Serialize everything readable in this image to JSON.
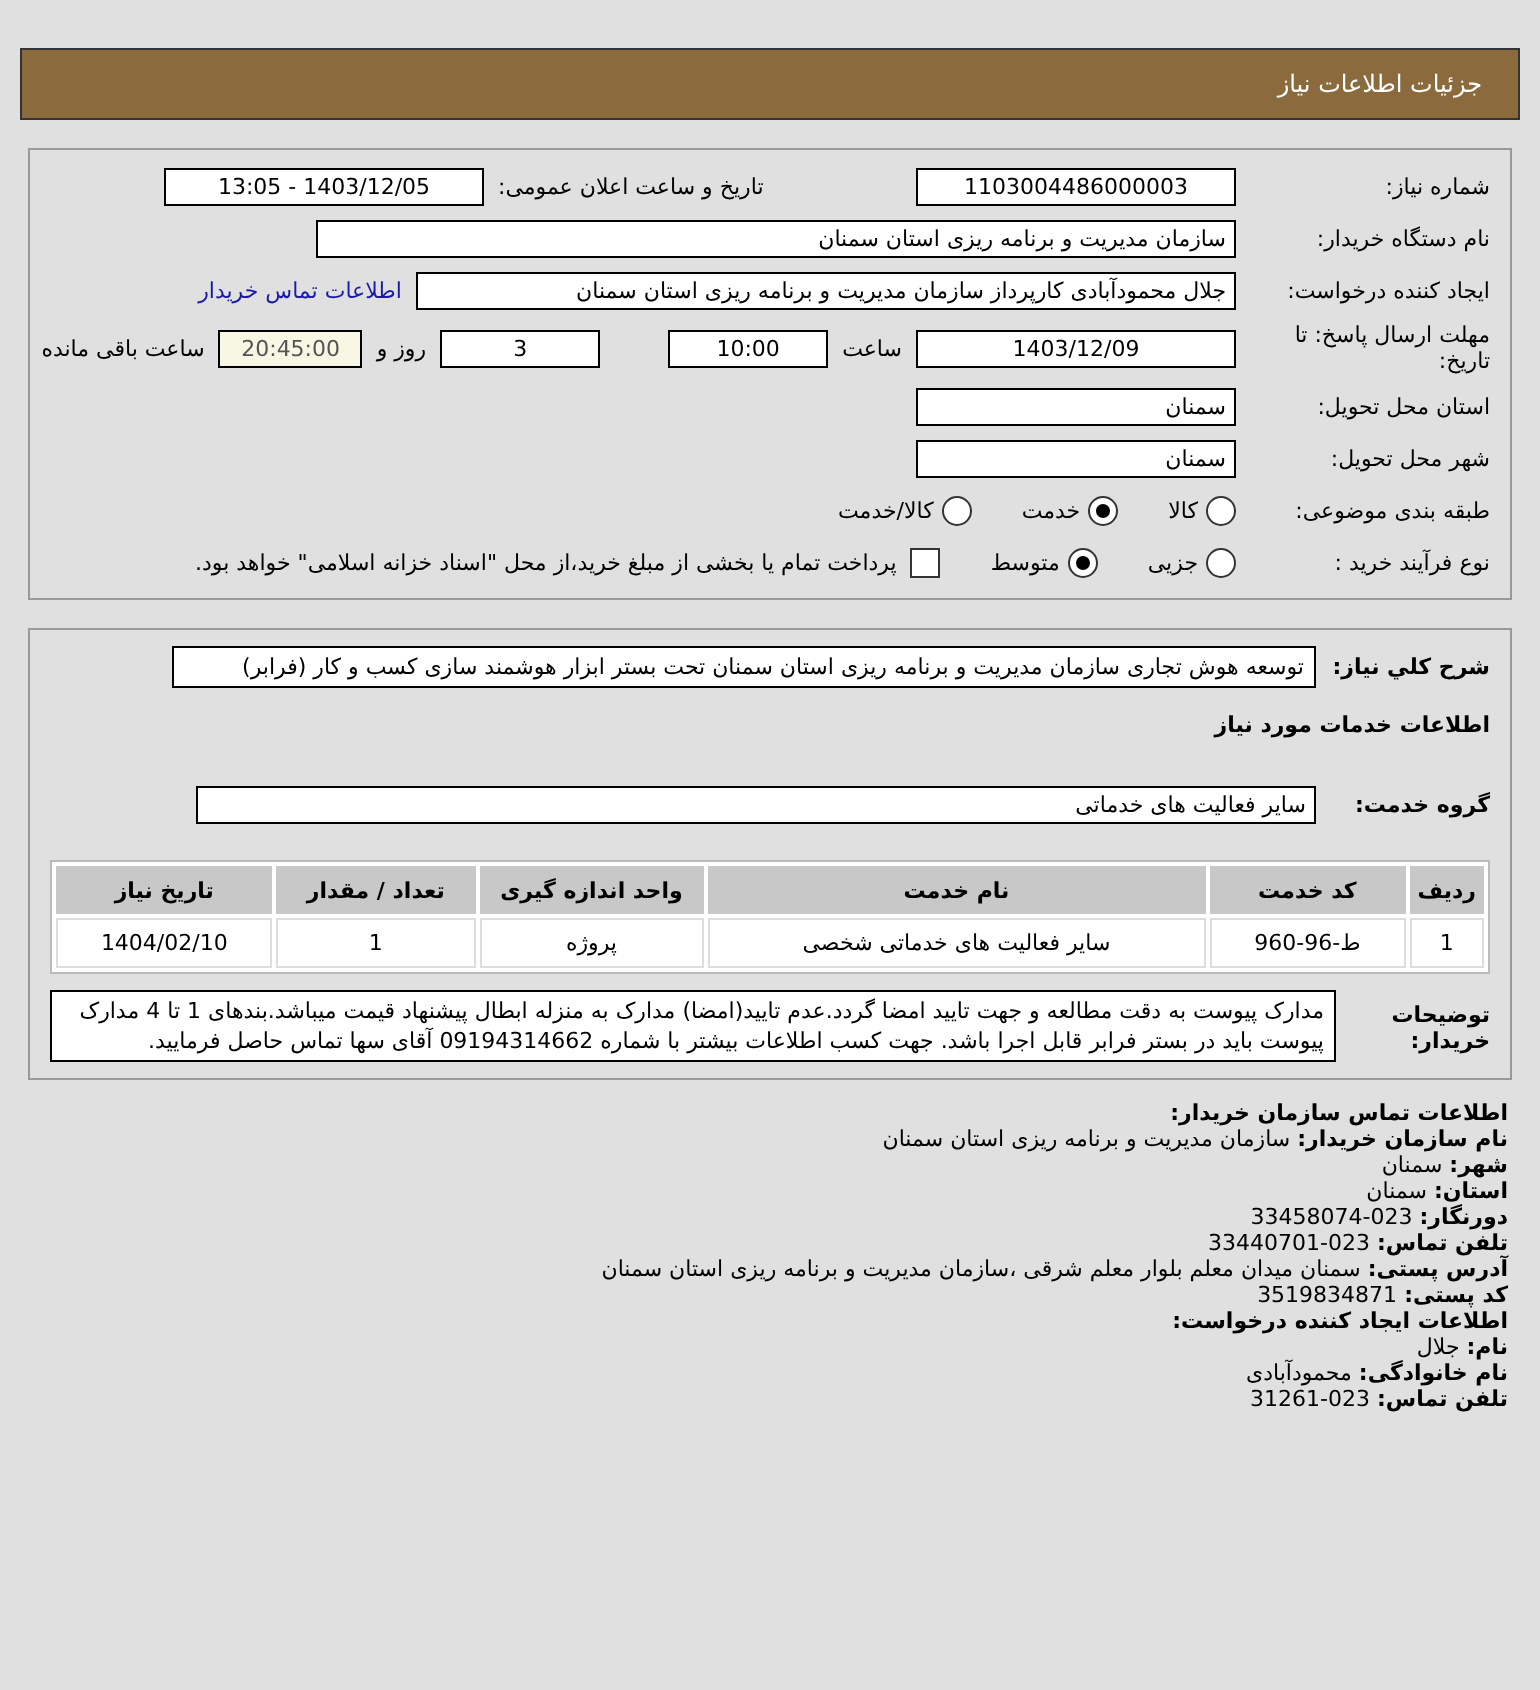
{
  "header": {
    "title": "جزئیات اطلاعات نیاز"
  },
  "need_info": {
    "need_number_label": "شماره نیاز:",
    "need_number": "1103004486000003",
    "announce_label": "تاریخ و ساعت اعلان عمومی:",
    "announce_value": "1403/12/05 - 13:05",
    "buyer_label": "نام دستگاه خریدار:",
    "buyer": "سازمان مدیریت و برنامه ریزی استان سمنان",
    "creator_label": "ایجاد کننده درخواست:",
    "creator": "جلال محمودآبادی کارپرداز سازمان مدیریت و برنامه ریزی استان سمنان",
    "contact_link": "اطلاعات تماس خریدار",
    "deadline_label": "مهلت ارسال پاسخ: تا تاریخ:",
    "deadline_date": "1403/12/09",
    "time_label": "ساعت",
    "deadline_time": "10:00",
    "days": "3",
    "days_label": "روز و",
    "remaining": "20:45:00",
    "remaining_label": "ساعت باقی مانده",
    "province_label": "استان محل تحویل:",
    "province": "سمنان",
    "city_label": "شهر محل تحویل:",
    "city": "سمنان",
    "category_label": "طبقه بندی موضوعی:",
    "category_options": [
      {
        "label": "کالا",
        "selected": false
      },
      {
        "label": "خدمت",
        "selected": true
      },
      {
        "label": "کالا/خدمت",
        "selected": false
      }
    ],
    "process_label": "نوع فرآیند خرید :",
    "process_options": [
      {
        "label": "جزیی",
        "selected": false
      },
      {
        "label": "متوسط",
        "selected": true
      }
    ],
    "treasury": {
      "label": "پرداخت تمام یا بخشی از مبلغ خرید،از محل \"اسناد خزانه اسلامی\" خواهد بود.",
      "checked": false
    }
  },
  "details": {
    "summary_label": "شرح کلي نياز:",
    "summary": "توسعه هوش تجاری سازمان مدیریت و برنامه ریزی استان سمنان تحت بستر ابزار هوشمند سازی کسب و کار (فرابر)",
    "services_title": "اطلاعات خدمات مورد نیاز",
    "group_label": "گروه خدمت:",
    "group": "سایر فعالیت های خدماتی",
    "table": {
      "columns": [
        "ردیف",
        "کد خدمت",
        "نام خدمت",
        "واحد اندازه گیری",
        "تعداد / مقدار",
        "تاریخ نیاز"
      ],
      "rows": [
        [
          "1",
          "ط-96-960",
          "سایر فعالیت های خدماتی شخصی",
          "پروژه",
          "1",
          "1404/02/10"
        ]
      ]
    },
    "notes_label": "توضیحات خریدار:",
    "notes": "مدارک پیوست به دقت مطالعه و جهت تایید امضا گردد.عدم تایید(امضا) مدارک به منزله ابطال پیشنهاد قیمت میباشد.بندهای 1 تا 4 مدارک پیوست باید در بستر فرابر قابل اجرا باشد. جهت کسب اطلاعات بیشتر با شماره 09194314662 آقای سها تماس حاصل فرمایید."
  },
  "contact": [
    {
      "kind": "heading",
      "label": "اطلاعات تماس سازمان خریدار:"
    },
    {
      "kind": "field",
      "label": "نام سازمان خریدار:",
      "value": "سازمان مدیریت و برنامه ریزی استان سمنان"
    },
    {
      "kind": "field",
      "label": "شهر:",
      "value": "سمنان"
    },
    {
      "kind": "field",
      "label": "استان:",
      "value": "سمنان"
    },
    {
      "kind": "field",
      "label": "دورنگار:",
      "value": "023-33458074"
    },
    {
      "kind": "field",
      "label": "تلفن تماس:",
      "value": "023-33440701"
    },
    {
      "kind": "field",
      "label": "آدرس پستی:",
      "value": "سمنان میدان معلم بلوار معلم شرقی ،سازمان مدیریت و برنامه ریزی استان سمنان"
    },
    {
      "kind": "field",
      "label": "کد پستی:",
      "value": "3519834871"
    },
    {
      "kind": "heading",
      "label": "اطلاعات ایجاد کننده درخواست:"
    },
    {
      "kind": "field",
      "label": "نام:",
      "value": "جلال"
    },
    {
      "kind": "field",
      "label": "نام خانوادگی:",
      "value": "محمودآبادی"
    },
    {
      "kind": "field",
      "label": "تلفن تماس:",
      "value": "023-31261"
    }
  ]
}
